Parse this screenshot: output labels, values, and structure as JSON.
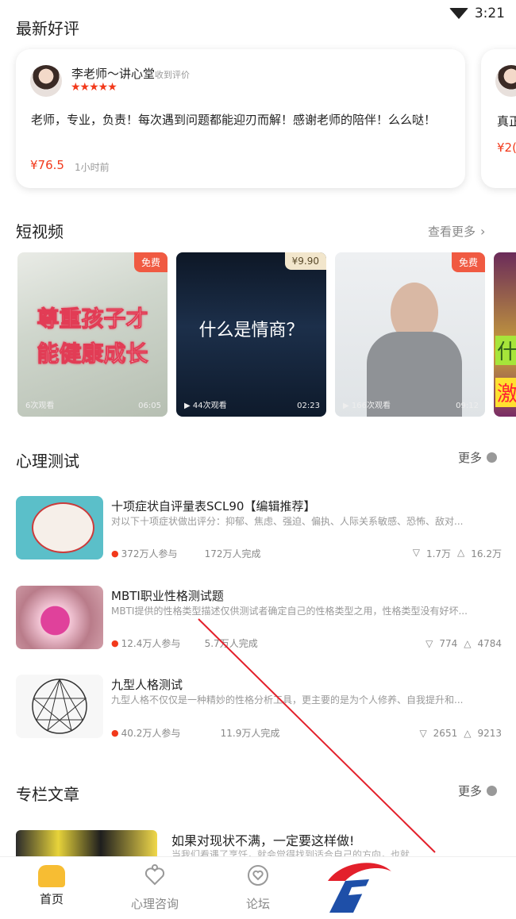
{
  "status_bar": {
    "time": "3:21",
    "wifi_icon": "wifi-icon"
  },
  "reviews": {
    "section_title": "最新好评",
    "cards": [
      {
        "name": "李老师～讲心堂",
        "received": "收到评价",
        "stars": "★★★★★",
        "text": "老师，专业，负责！每次遇到问题都能迎刃而解！感谢老师的陪伴！么么哒！",
        "price": "¥76.5",
        "time": "1小时前"
      },
      {
        "text_partial": "真正",
        "price_partial": "¥2("
      }
    ]
  },
  "videos": {
    "section_title": "短视频",
    "more_label": "查看更多",
    "items": [
      {
        "tag": "免费",
        "title_l1": "尊重孩子才",
        "title_l2": "能健康成长",
        "views": "6次观看",
        "duration": "06:05"
      },
      {
        "tag": "¥9.90",
        "title_l1": "什么是情商？",
        "views": "44次观看",
        "duration": "02:23"
      },
      {
        "tag": "免费",
        "views": "166次观看",
        "duration": "09:12"
      },
      {
        "title_partial_l1": "什",
        "title_partial_l2": "激"
      }
    ]
  },
  "tests": {
    "section_title": "心理测试",
    "more_label": "更多",
    "items": [
      {
        "title": "十项症状自评量表SCL90【编辑推荐】",
        "desc": "对以下十项症状做出评分：抑郁、焦虑、强迫、偏执、人际关系敏感、恐怖、敌对...",
        "participants": "372万人参与",
        "completed": "172万人完成",
        "comments": "1.7万",
        "likes": "16.2万"
      },
      {
        "title": "MBTI职业性格测试题",
        "desc": "MBTI提供的性格类型描述仅供测试者确定自己的性格类型之用，性格类型没有好坏...",
        "participants": "12.4万人参与",
        "completed": "5.7万人完成",
        "comments": "774",
        "likes": "4784"
      },
      {
        "title": "九型人格测试",
        "desc": "九型人格不仅仅是一种精妙的性格分析工具，更主要的是为个人修养、自我提升和...",
        "participants": "40.2万人参与",
        "completed": "11.9万人完成",
        "comments": "2651",
        "likes": "9213"
      }
    ]
  },
  "articles": {
    "section_title": "专栏文章",
    "more_label": "更多",
    "items": [
      {
        "title": "如果对现状不满，一定要这样做!",
        "desc": "当我们看遇了烹饪，就会觉得找到适合自己的方向，也就..."
      }
    ]
  },
  "tabbar": {
    "tabs": [
      {
        "label": "首页",
        "icon": "home-icon",
        "active": true
      },
      {
        "label": "心理咨询",
        "icon": "heart-hand-icon",
        "active": false
      },
      {
        "label": "论坛",
        "icon": "forum-icon",
        "active": false
      }
    ]
  },
  "colors": {
    "accent_red": "#f2391b",
    "tab_active": "#f7bd33",
    "tag_free": "#f05a42"
  }
}
